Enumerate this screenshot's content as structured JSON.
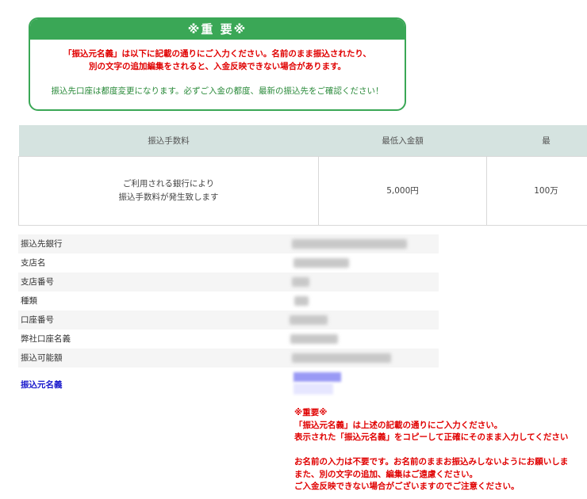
{
  "notice": {
    "title": "※重 要※",
    "red_lines": [
      "「振込元名義」は以下に記載の通りにご入力ください。名前のまま振込されたり、",
      "別の文字の追加編集をされると、入金反映できない場合があります。"
    ],
    "green_line": "振込先口座は都度変更になります。必ずご入金の都度、最新の振込先をご確認ください！"
  },
  "fees": {
    "headers": [
      "振込手数料",
      "最低入金額",
      "最"
    ],
    "fee_text": [
      "ご利用される銀行により",
      "振込手数料が発生致します"
    ],
    "min_amount": "5,000円",
    "max_amount": "100万"
  },
  "account": {
    "rows": [
      {
        "label": "振込先銀行"
      },
      {
        "label": "支店名"
      },
      {
        "label": "支店番号"
      },
      {
        "label": "種類"
      },
      {
        "label": "口座番号"
      },
      {
        "label": "弊社口座名義"
      },
      {
        "label": "振込可能額"
      }
    ],
    "source_name_label": "振込元名義"
  },
  "warning": {
    "lines": [
      "※重要※",
      "「振込元名義」は上述の記載の通りにご入力ください。",
      "表示された「振込元名義」をコピーして正確にそのまま入力してください",
      "",
      "お名前の入力は不要です。お名前のままお振込みしないようにお願いしま",
      "また、別の文字の追加、編集はご遠慮ください。",
      "ご入金反映できない場合がございますのでご注意ください。"
    ]
  },
  "colors": {
    "accent_green": "#3aa756",
    "warning_red": "#e00000",
    "table_header": "#d5e3e0",
    "link_blue": "#1a1acc"
  }
}
